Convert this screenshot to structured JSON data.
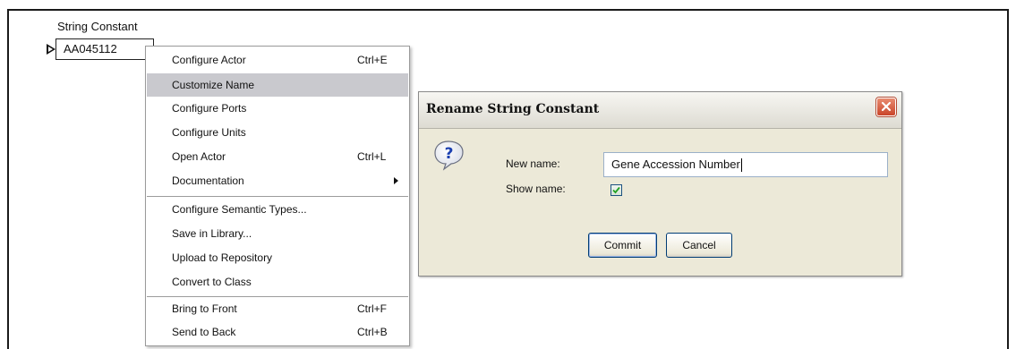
{
  "actor": {
    "title": "String Constant",
    "value": "AA045112"
  },
  "context_menu": {
    "items": [
      {
        "label": "Configure Actor",
        "shortcut": "Ctrl+E"
      },
      {
        "label": "Customize Name",
        "shortcut": "",
        "highlighted": true
      },
      {
        "label": "Configure Ports",
        "shortcut": ""
      },
      {
        "label": "Configure Units",
        "shortcut": ""
      },
      {
        "label": "Open Actor",
        "shortcut": "Ctrl+L"
      },
      {
        "label": "Documentation",
        "shortcut": "",
        "submenu": true
      },
      {
        "label": "Configure Semantic Types...",
        "shortcut": ""
      },
      {
        "label": "Save in Library...",
        "shortcut": ""
      },
      {
        "label": "Upload to Repository",
        "shortcut": ""
      },
      {
        "label": "Convert to Class",
        "shortcut": ""
      },
      {
        "label": "Bring to Front",
        "shortcut": "Ctrl+F"
      },
      {
        "label": "Send to Back",
        "shortcut": "Ctrl+B"
      }
    ]
  },
  "dialog": {
    "title": "Rename String Constant",
    "new_name_label": "New name:",
    "new_name_value": "Gene Accession Number",
    "show_name_label": "Show name:",
    "show_name_checked": true,
    "commit_label": "Commit",
    "cancel_label": "Cancel",
    "icons": {
      "help": "question-icon",
      "close": "close-icon"
    }
  },
  "colors": {
    "menu_highlight": "#c9c9ce",
    "dialog_bg": "#ece9d8",
    "close_button": "#c9452a",
    "help_icon": "#1a3fb0"
  }
}
